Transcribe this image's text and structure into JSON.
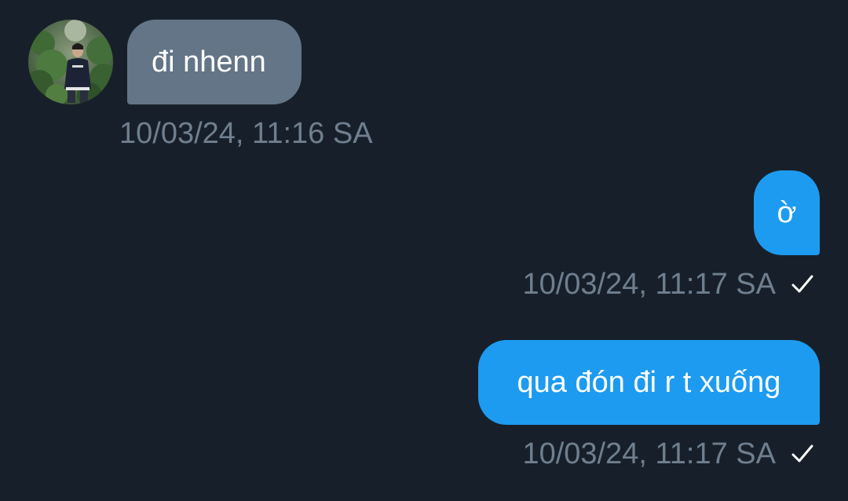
{
  "conversation": {
    "messages": [
      {
        "direction": "incoming",
        "text": "đi nhenn",
        "timestamp": "10/03/24, 11:16 SA",
        "sender_avatar_icon": "user-avatar-photo"
      },
      {
        "direction": "outgoing",
        "text": "ờ",
        "timestamp": "10/03/24, 11:17 SA",
        "status_icon": "checkmark-icon"
      },
      {
        "direction": "outgoing",
        "text": "qua đón đi r t xuống",
        "timestamp": "10/03/24, 11:17 SA",
        "status_icon": "checkmark-icon"
      }
    ]
  },
  "colors": {
    "background": "#17202a",
    "incoming_bubble": "#637586",
    "outgoing_bubble": "#1d9bf0",
    "timestamp_text": "#6f7f8f",
    "bubble_text": "#ffffff"
  }
}
